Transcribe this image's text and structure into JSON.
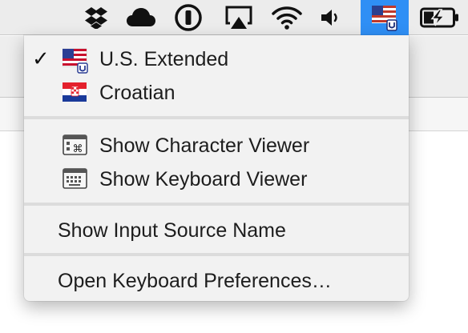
{
  "menubar": {
    "icons": [
      "dropbox-icon",
      "cloud-icon",
      "1password-icon",
      "airplay-icon",
      "wifi-icon",
      "volume-icon",
      "input-source-flag-icon",
      "battery-charging-icon"
    ],
    "active_color": "#2f8ff5"
  },
  "menu": {
    "input_sources": [
      {
        "label": "U.S. Extended",
        "checked": true,
        "icon": "us-flag-icon"
      },
      {
        "label": "Croatian",
        "checked": false,
        "icon": "croatian-flag-icon"
      }
    ],
    "viewers": [
      {
        "label": "Show Character Viewer",
        "icon": "character-viewer-icon"
      },
      {
        "label": "Show Keyboard Viewer",
        "icon": "keyboard-viewer-icon"
      }
    ],
    "show_input_source_name": "Show Input Source Name",
    "open_keyboard_preferences": "Open Keyboard Preferences…",
    "checkmark": "✓"
  }
}
